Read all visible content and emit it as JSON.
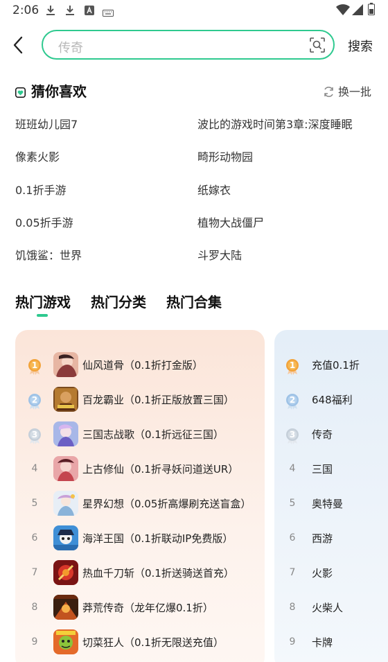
{
  "status": {
    "time": "2:06",
    "icons": [
      "download-icon",
      "download-icon",
      "a-icon",
      "keyboard-icon",
      "wifi-icon",
      "signal-icon",
      "battery-icon"
    ]
  },
  "search": {
    "placeholder": "传奇",
    "button_label": "搜索"
  },
  "guess": {
    "title": "猜你喜欢",
    "refresh_label": "换一批",
    "items": [
      "班班幼儿园7",
      "波比的游戏时间第3章:深度睡眠",
      "像素火影",
      "畸形动物园",
      "0.1折手游",
      "纸嫁衣",
      "0.05折手游",
      "植物大战僵尸",
      "饥饿鲨：世界",
      "斗罗大陆"
    ]
  },
  "tabs": [
    "热门游戏",
    "热门分类",
    "热门合集"
  ],
  "hot_games": [
    {
      "rank": "1",
      "name": "仙风道骨（0.1折打金版）"
    },
    {
      "rank": "2",
      "name": "百龙霸业（0.1折正版放置三国）"
    },
    {
      "rank": "3",
      "name": "三国志战歌（0.1折远征三国）"
    },
    {
      "rank": "4",
      "name": "上古修仙（0.1折寻妖问道送UR）"
    },
    {
      "rank": "5",
      "name": "星界幻想（0.05折高爆刷充送盲盒）"
    },
    {
      "rank": "6",
      "name": "海洋王国（0.1折联动IP免费版）"
    },
    {
      "rank": "7",
      "name": "热血千刀斩（0.1折送骑送首充）"
    },
    {
      "rank": "8",
      "name": "莽荒传奇（龙年亿爆0.1折）"
    },
    {
      "rank": "9",
      "name": "切菜狂人（0.1折无限送充值）"
    }
  ],
  "hot_categories": [
    {
      "rank": "1",
      "name": "充值0.1折"
    },
    {
      "rank": "2",
      "name": "648福利"
    },
    {
      "rank": "3",
      "name": "传奇"
    },
    {
      "rank": "4",
      "name": "三国"
    },
    {
      "rank": "5",
      "name": "奥特曼"
    },
    {
      "rank": "6",
      "name": "西游"
    },
    {
      "rank": "7",
      "name": "火影"
    },
    {
      "rank": "8",
      "name": "火柴人"
    },
    {
      "rank": "9",
      "name": "卡牌"
    }
  ],
  "colors": {
    "accent": "#2ec98f",
    "gold": "#f0a030",
    "silver": "#a9c8e8",
    "bronze": "#c9d4de"
  }
}
